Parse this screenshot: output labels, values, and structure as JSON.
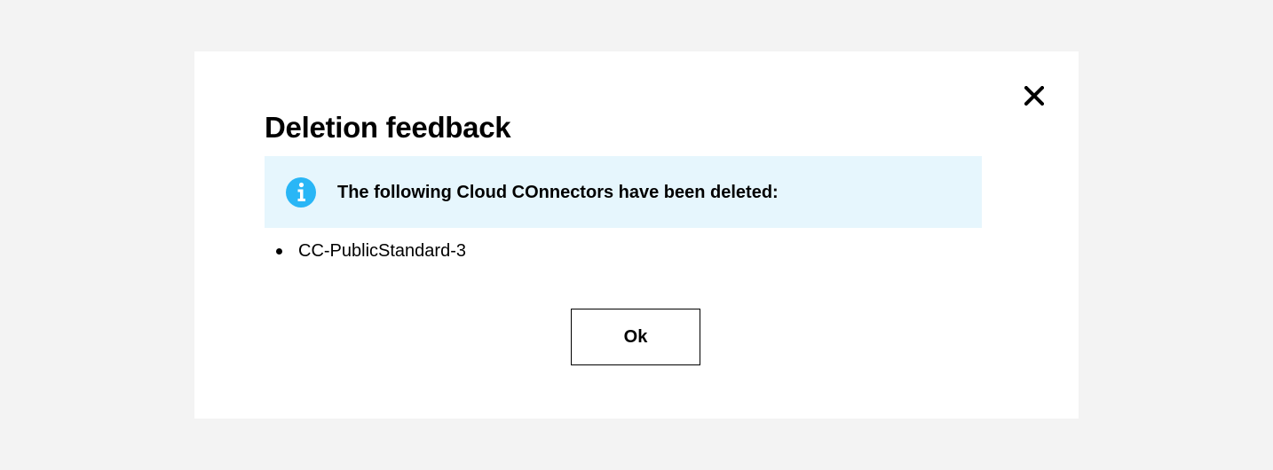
{
  "dialog": {
    "title": "Deletion feedback",
    "close_icon": "close-icon",
    "notice": {
      "icon": "info-icon",
      "icon_color": "#29b6f6",
      "background": "#e6f6fd",
      "text": "The following Cloud COnnectors have been deleted:"
    },
    "deleted_items": [
      "CC-PublicStandard-3"
    ],
    "ok_label": "Ok"
  }
}
